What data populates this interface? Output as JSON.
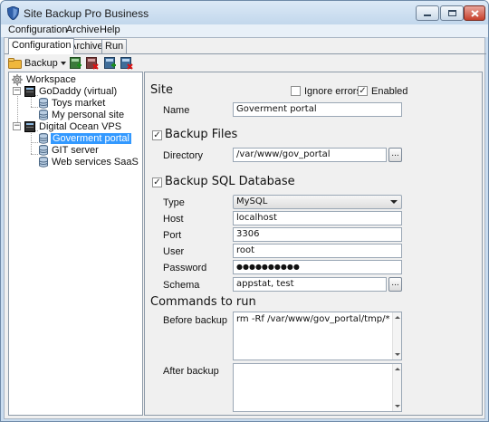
{
  "window": {
    "title": "Site Backup Pro Business",
    "controls": {
      "minimize": "minimize",
      "maximize": "maximize",
      "close": "close"
    }
  },
  "menu": [
    "Configuration",
    "Archive",
    "Help"
  ],
  "tabs": [
    "Configuration",
    "Archive",
    "Run"
  ],
  "toolbar": {
    "backup_label": "Backup",
    "icons": [
      "add-icon",
      "remove-icon",
      "add-site-icon",
      "delete-site-icon"
    ]
  },
  "tree": {
    "root": "Workspace",
    "groups": [
      {
        "label": "GoDaddy (virtual)",
        "children": [
          "Toys market",
          "My personal site"
        ]
      },
      {
        "label": "Digital Ocean VPS",
        "children": [
          "Goverment portal",
          "GIT server",
          "Web services SaaS"
        ]
      }
    ],
    "selected": "Goverment portal"
  },
  "site": {
    "section_title": "Site",
    "ignore_errors_label": "Ignore errors",
    "ignore_errors_checked": false,
    "enabled_label": "Enabled",
    "enabled_checked": true,
    "name_label": "Name",
    "name_value": "Goverment portal"
  },
  "backup_files": {
    "section_title": "Backup Files",
    "checked": true,
    "directory_label": "Directory",
    "directory_value": "/var/www/gov_portal",
    "browse_label": "..."
  },
  "backup_sql": {
    "section_title": "Backup SQL Database",
    "checked": true,
    "type_label": "Type",
    "type_value": "MySQL",
    "host_label": "Host",
    "host_value": "localhost",
    "port_label": "Port",
    "port_value": "3306",
    "user_label": "User",
    "user_value": "root",
    "password_label": "Password",
    "password_value": "●●●●●●●●●●",
    "schema_label": "Schema",
    "schema_value": "appstat, test",
    "browse_label": "..."
  },
  "commands": {
    "section_title": "Commands to run",
    "before_label": "Before backup",
    "before_value": "rm -Rf /var/www/gov_portal/tmp/*",
    "after_label": "After backup",
    "after_value": ""
  },
  "colors": {
    "selection": "#3399ff",
    "titlebar": "#c9dcef",
    "close_button": "#c7402c"
  }
}
